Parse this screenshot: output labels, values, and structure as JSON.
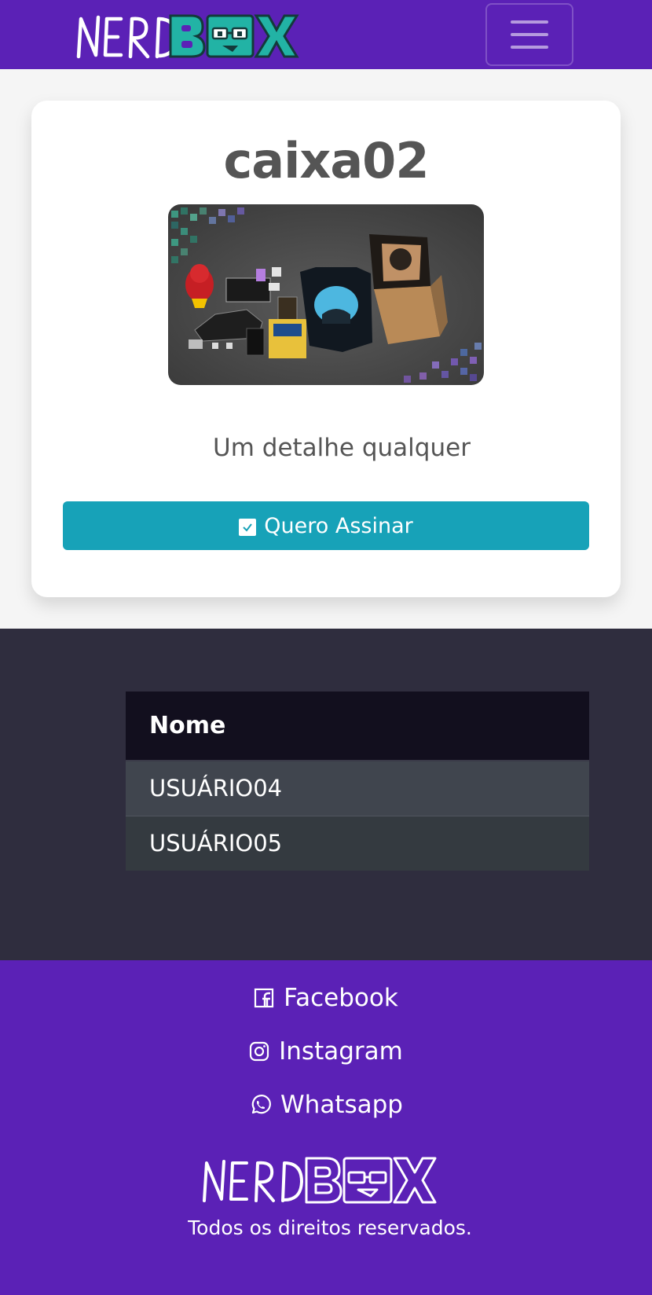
{
  "navbar": {
    "logo_text": "NERDBOX",
    "menu_icon": "hamburger-menu-icon"
  },
  "card": {
    "title": "caixa02",
    "image_icon": "product-box-image",
    "text": "Um detalhe qualquer",
    "button_label": "Quero Assinar",
    "button_icon": "checkbox-icon"
  },
  "table": {
    "header": "Nome",
    "rows": [
      "USUÁRIO04",
      "USUÁRIO05"
    ]
  },
  "footer": {
    "links": [
      {
        "label": "Facebook",
        "icon": "facebook-icon"
      },
      {
        "label": "Instagram",
        "icon": "instagram-icon"
      },
      {
        "label": "Whatsapp",
        "icon": "whatsapp-icon"
      }
    ],
    "logo_text": "NERDBOX",
    "copyright": "Todos os direitos reservados."
  },
  "colors": {
    "brand_purple": "#5b21b6",
    "accent_teal": "#17a2b8",
    "logo_teal": "#22b3a5",
    "dark_section": "#2f2d3e"
  }
}
